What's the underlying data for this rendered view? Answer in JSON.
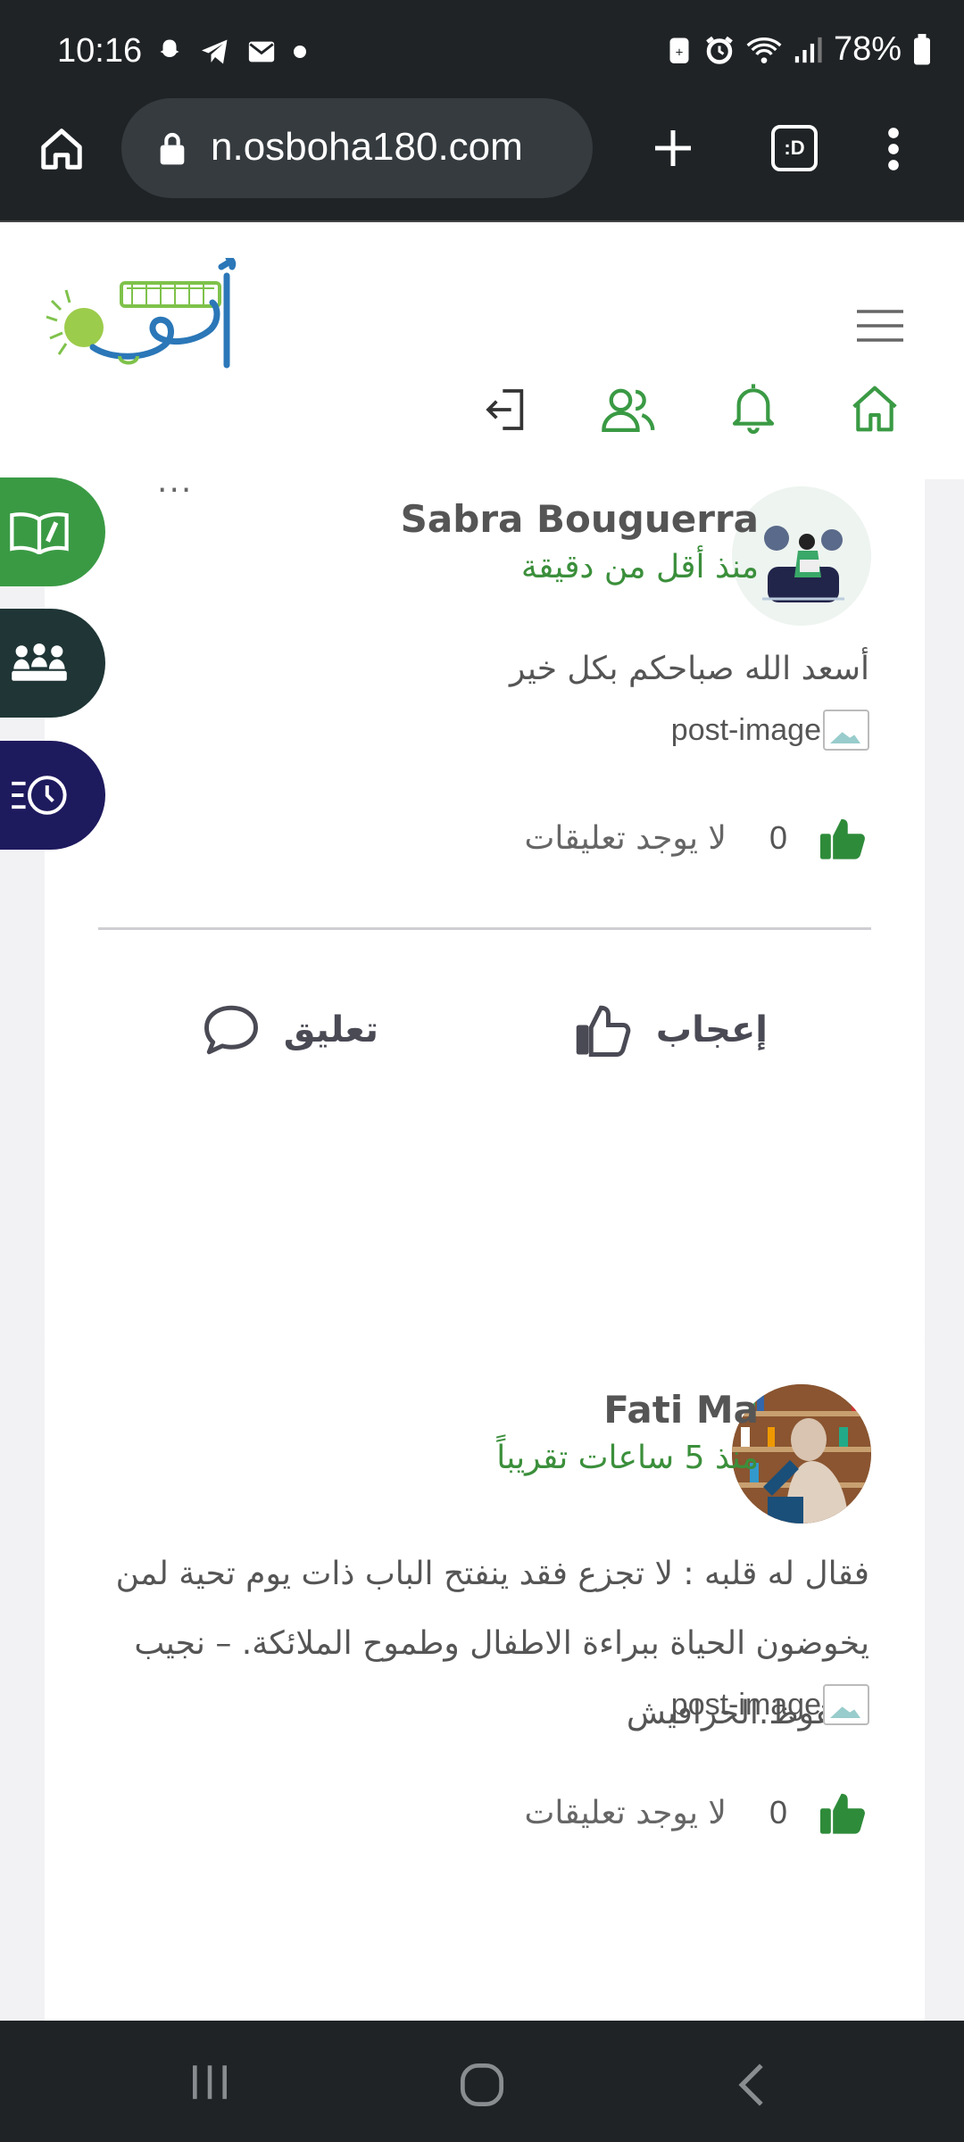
{
  "status_bar": {
    "time": "10:16",
    "battery": "78%"
  },
  "browser": {
    "url": "n.osboha180.com",
    "tab_count": ":D"
  },
  "site": {
    "logo_alt": "أصبوحة 180",
    "brand_color": "#3a9a44"
  },
  "posts": [
    {
      "author": "Sabra Bouguerra",
      "time_ago": "منذ أقل من دقيقة",
      "text": "أسعد الله صباحكم بكل خير",
      "image_alt": "post-image",
      "likes": "0",
      "comments_label": "لا يوجد تعليقات"
    },
    {
      "author": "Fati Ma",
      "time_ago": "منذ 5 ساعات تقريباً",
      "text": "فقال له قلبه : لا تجزع فقد ينفتح الباب ذات يوم تحية لمن يخوضون الحياة ببراءة الاطفال وطموح الملائكة. – نجيب محفوظ.الحرافيش",
      "image_alt": "post-image",
      "likes": "0",
      "comments_label": "لا يوجد تعليقات"
    }
  ],
  "actions": {
    "like_label": "إعجاب",
    "comment_label": "تعليق",
    "more": "···"
  }
}
